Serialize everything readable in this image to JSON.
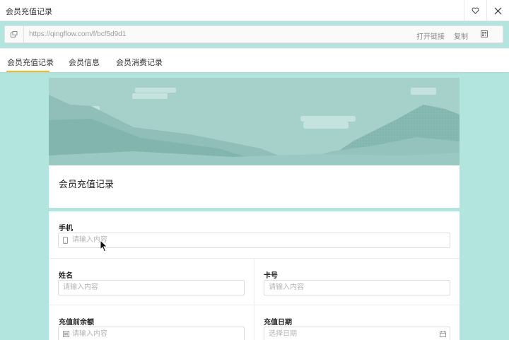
{
  "window": {
    "title": "会员充值记录"
  },
  "urlbar": {
    "url": "https://qingflow.com/f/bcf5d9d1",
    "open_link": "打开链接",
    "copy": "复制"
  },
  "tabs": [
    {
      "label": "会员充值记录",
      "active": true
    },
    {
      "label": "会员信息",
      "active": false
    },
    {
      "label": "会员消费记录",
      "active": false
    }
  ],
  "form": {
    "title": "会员充值记录",
    "fields": {
      "phone": {
        "label": "手机",
        "placeholder": "请输入内容"
      },
      "name": {
        "label": "姓名",
        "placeholder": "请输入内容"
      },
      "card": {
        "label": "卡号",
        "placeholder": "请输入内容"
      },
      "balance_before": {
        "label": "充值前余额",
        "placeholder": "请输入内容"
      },
      "date": {
        "label": "充值日期",
        "placeholder": "选择日期"
      }
    }
  },
  "colors": {
    "background": "#b3e5df",
    "tab_indicator": "#f5b923",
    "banner": "#a2cdc7"
  }
}
